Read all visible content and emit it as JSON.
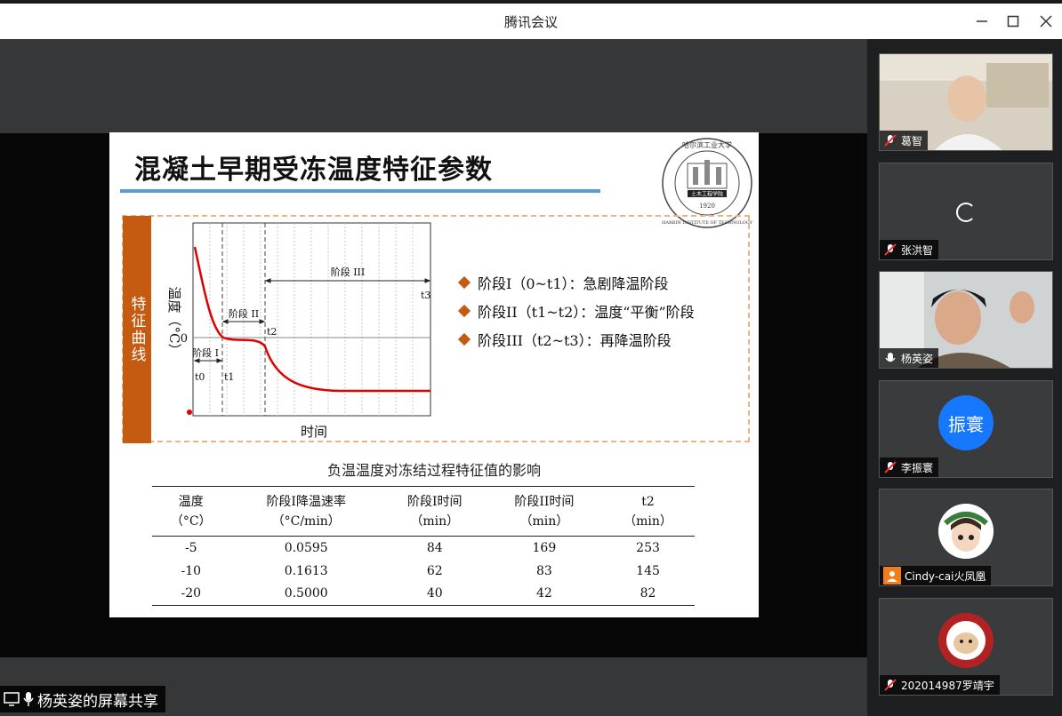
{
  "window": {
    "title": "腾讯会议"
  },
  "slide": {
    "title": "混凝土早期受冻温度特征参数",
    "logo": {
      "top_text": "哈尔滨工业大学",
      "center_text": "土木工程学院",
      "year": "1920",
      "bottom_text": "HARBIN INSTITUTE OF TECHNOLOGY"
    },
    "panel_tag": "特征曲线",
    "chart": {
      "ylabel": "温度（°C）",
      "xlabel": "时间",
      "zero_label": "0",
      "phase1_label": "阶段 I",
      "phase2_label": "阶段 II",
      "phase3_label": "阶段 III",
      "t0": "t0",
      "t1": "t1",
      "t2": "t2",
      "t3": "t3"
    },
    "bullets": [
      "阶段I（0~t1）：急剧降温阶段",
      "阶段II（t1~t2）：温度“平衡”阶段",
      "阶段III（t2~t3）：再降温阶段"
    ],
    "table_caption": "负温温度对冻结过程特征值的影响",
    "table": {
      "headers": [
        {
          "l1": "温度",
          "l2": "（°C）"
        },
        {
          "l1": "阶段I降温速率",
          "l2": "（°C/min）"
        },
        {
          "l1": "阶段I时间",
          "l2": "（min）"
        },
        {
          "l1": "阶段II时间",
          "l2": "（min）"
        },
        {
          "l1": "t2",
          "l2": "（min）"
        }
      ],
      "rows": [
        [
          "-5",
          "0.0595",
          "84",
          "169",
          "253"
        ],
        [
          "-10",
          "0.1613",
          "62",
          "83",
          "145"
        ],
        [
          "-20",
          "0.5000",
          "40",
          "42",
          "82"
        ]
      ]
    }
  },
  "share_label": "杨英姿的屏幕共享",
  "participants": [
    {
      "name": "葛智",
      "kind": "video",
      "muted": true
    },
    {
      "name": "张洪智",
      "kind": "loading",
      "muted": true
    },
    {
      "name": "杨英姿",
      "kind": "video",
      "muted": false
    },
    {
      "name": "李振寰",
      "kind": "initials",
      "initials": "振寰",
      "color": "#1677ff",
      "muted": true
    },
    {
      "name": "Cindy-cai火凤凰",
      "kind": "avatar",
      "muted": false
    },
    {
      "name": "202014987罗靖宇",
      "kind": "avatar",
      "muted": true
    }
  ],
  "colors": {
    "accent_orange": "#c55a11",
    "blue_rule": "#5b9bd5",
    "curve_red": "#e00000"
  }
}
